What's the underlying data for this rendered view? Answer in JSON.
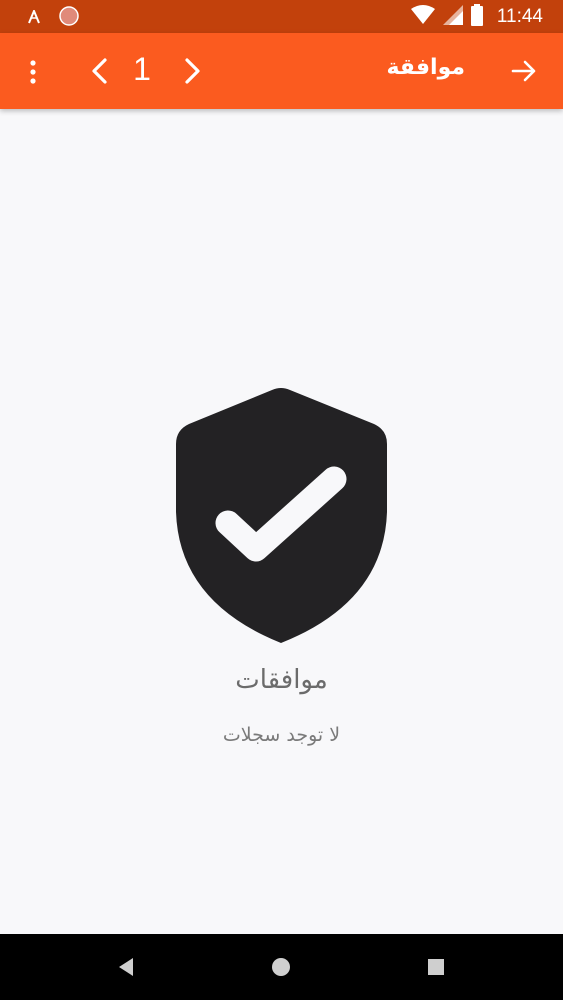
{
  "status_bar": {
    "time": "11:44",
    "icons": [
      "signal-notification-icon",
      "app-notification-icon",
      "wifi-icon",
      "cellular-signal-icon",
      "battery-icon"
    ]
  },
  "app_bar": {
    "title": "موافقة",
    "page_number": "1",
    "icons": [
      "back-arrow-icon",
      "next-page-icon",
      "previous-page-icon",
      "more-options-icon"
    ]
  },
  "empty_state": {
    "icon": "shield-check-icon",
    "title": "موافقات",
    "subtitle": "لا توجد سجلات"
  },
  "nav_bar": {
    "icons": [
      "nav-back-icon",
      "nav-home-icon",
      "nav-recents-icon"
    ]
  },
  "colors": {
    "status_bar": "#c2410c",
    "app_bar": "#fb5b1f",
    "background": "#f8f8fa",
    "shield": "#232224",
    "nav_bar": "#000000"
  }
}
